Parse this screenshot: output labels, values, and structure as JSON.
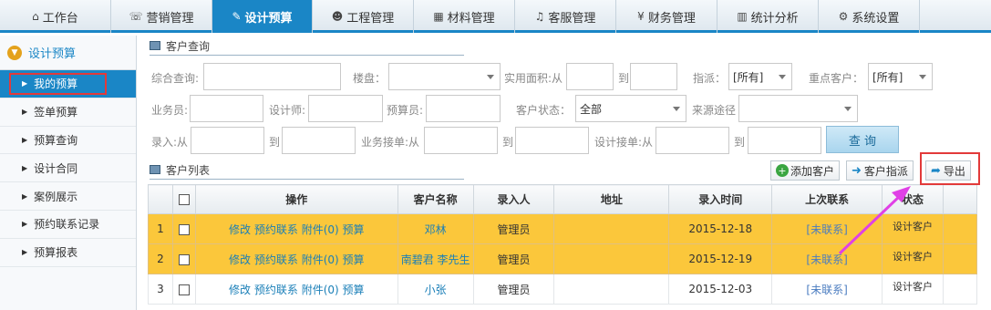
{
  "topnav": {
    "tabs": [
      {
        "label": "工作台",
        "icon": "home-icon",
        "glyph": "⌂"
      },
      {
        "label": "营销管理",
        "icon": "chat-icon",
        "glyph": "☏"
      },
      {
        "label": "设计预算",
        "icon": "edit-icon",
        "glyph": "✎"
      },
      {
        "label": "工程管理",
        "icon": "users-icon",
        "glyph": "☻"
      },
      {
        "label": "材料管理",
        "icon": "grid-icon",
        "glyph": "▦"
      },
      {
        "label": "客服管理",
        "icon": "headset-icon",
        "glyph": "♫"
      },
      {
        "label": "财务管理",
        "icon": "yen-icon",
        "glyph": "¥"
      },
      {
        "label": "统计分析",
        "icon": "chart-icon",
        "glyph": "▥"
      },
      {
        "label": "系统设置",
        "icon": "gear-icon",
        "glyph": "⚙"
      }
    ]
  },
  "sidebar": {
    "title": "设计预算",
    "items": [
      {
        "label": "我的预算"
      },
      {
        "label": "签单预算"
      },
      {
        "label": "预算查询"
      },
      {
        "label": "设计合同"
      },
      {
        "label": "案例展示"
      },
      {
        "label": "预约联系记录"
      },
      {
        "label": "预算报表"
      }
    ]
  },
  "query": {
    "title": "客户查询",
    "labels": {
      "general": "综合查询:",
      "building": "楼盘：",
      "area_from": "实用面积:从",
      "to": "到",
      "assign": "指派：",
      "key_customer": "重点客户：",
      "salesman": "业务员:",
      "designer": "设计师:",
      "budgeter": "预算员:",
      "status": "客户状态：",
      "source": "来源途径",
      "entry_from": "录入:从",
      "biz_from": "业务接单:从",
      "design_from": "设计接单:从"
    },
    "values": {
      "assign": "[所有]",
      "key_customer": "[所有]",
      "status": "全部"
    },
    "query_button": "查 询"
  },
  "list": {
    "title": "客户列表",
    "buttons": {
      "add": "添加客户",
      "assign": "客户指派",
      "export": "导出"
    },
    "columns": [
      "操作",
      "客户名称",
      "录入人",
      "地址",
      "录入时间",
      "上次联系",
      "状态"
    ],
    "actions": {
      "edit": "修改",
      "appoint": "预约联系",
      "attach": "附件(0)",
      "budget": "预算"
    },
    "rows": [
      {
        "no": "1",
        "name": "邓林",
        "entered_by": "管理员",
        "address": "",
        "time": "2015-12-18",
        "last_contact": "[未联系]",
        "status": "设计客户"
      },
      {
        "no": "2",
        "name": "南碧君 李先生",
        "entered_by": "管理员",
        "address": "",
        "time": "2015-12-19",
        "last_contact": "[未联系]",
        "status": "设计客户"
      },
      {
        "no": "3",
        "name": "小张",
        "entered_by": "管理员",
        "address": "",
        "time": "2015-12-03",
        "last_contact": "[未联系]",
        "status": "设计客户"
      }
    ]
  }
}
